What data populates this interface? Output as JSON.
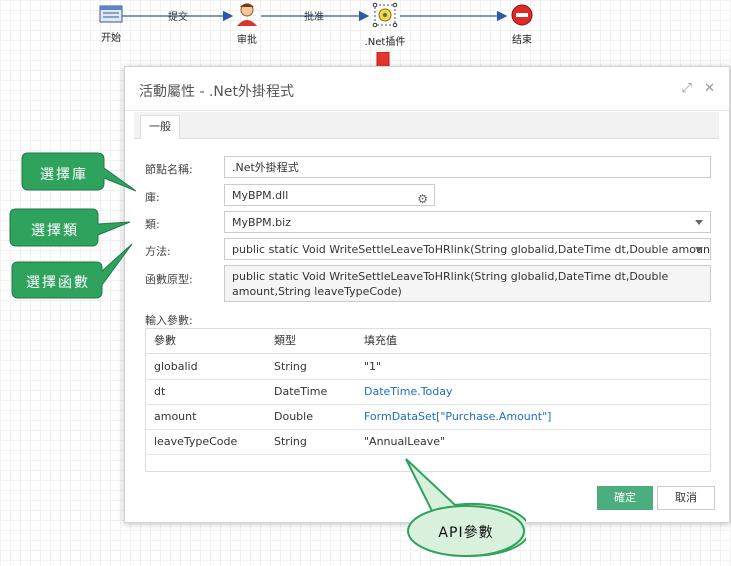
{
  "flow": {
    "nodes": [
      "开始",
      "审批",
      ".Net插件",
      "结束"
    ],
    "edges": [
      "提交",
      "批准"
    ]
  },
  "dialog": {
    "title": "活動屬性 - .Net外掛程式",
    "tab": "一般",
    "fields": {
      "node_name_label": "節點名稱:",
      "node_name_value": ".Net外掛程式",
      "library_label": "庫:",
      "library_value": "MyBPM.dll",
      "class_label": "類:",
      "class_value": "MyBPM.biz",
      "method_label": "方法:",
      "method_value": "public static Void WriteSettleLeaveToHRlink(String globalid,DateTime dt,Double amount,String",
      "prototype_label": "函數原型:",
      "prototype_value": "public static Void WriteSettleLeaveToHRlink(String globalid,DateTime dt,Double amount,String leaveTypeCode)",
      "params_label": "輸入參數:"
    },
    "table": {
      "headers": [
        "參數",
        "類型",
        "填充值"
      ],
      "rows": [
        [
          "globalid",
          "String",
          "\"1\""
        ],
        [
          "dt",
          "DateTime",
          "DateTime.Today"
        ],
        [
          "amount",
          "Double",
          "FormDataSet[\"Purchase.Amount\"]"
        ],
        [
          "leaveTypeCode",
          "String",
          "\"AnnualLeave\""
        ]
      ]
    },
    "buttons": {
      "ok": "確定",
      "cancel": "取消"
    }
  },
  "callouts": {
    "library": "選擇庫",
    "class": "選擇類",
    "function": "選擇函數",
    "api": "API參數"
  },
  "colors": {
    "accent": "#4cad7e",
    "callout_green": "#2fa25e",
    "callout_light": "#d9f0dc",
    "arrow_red": "#e8342b",
    "link_blue": "#1a6fc4"
  }
}
